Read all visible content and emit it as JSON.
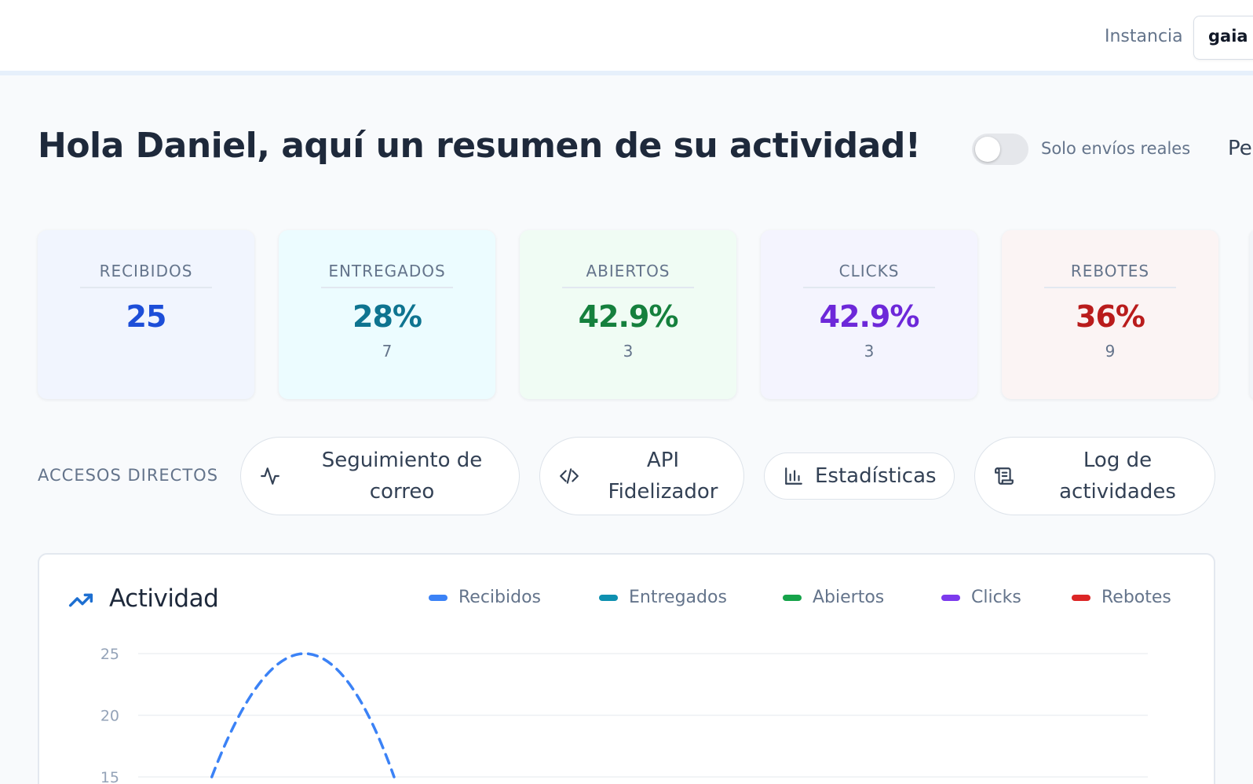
{
  "header": {
    "instance_label": "Instancia",
    "instance_value": "gaia"
  },
  "greeting": "Hola Daniel, aquí un resumen de su actividad!",
  "toggle": {
    "label": "Solo envíos reales",
    "checked": false
  },
  "truncated_text": "Pe",
  "stats": [
    {
      "title": "RECIBIDOS",
      "value": "25",
      "sub": "",
      "color": "#1d4ed8",
      "bg": "#f1f5fe"
    },
    {
      "title": "ENTREGADOS",
      "value": "28%",
      "sub": "7",
      "color": "#0e7490",
      "bg": "#ecfcff"
    },
    {
      "title": "ABIERTOS",
      "value": "42.9%",
      "sub": "3",
      "color": "#15803d",
      "bg": "#f0fcf4"
    },
    {
      "title": "CLICKS",
      "value": "42.9%",
      "sub": "3",
      "color": "#6d28d9",
      "bg": "#f4f4fe"
    },
    {
      "title": "REBOTES",
      "value": "36%",
      "sub": "9",
      "color": "#b91c1c",
      "bg": "#fbf4f4"
    }
  ],
  "shortcuts": {
    "label": "ACCESOS DIRECTOS",
    "items": [
      {
        "label": "Seguimiento de correo",
        "icon": "activity-icon"
      },
      {
        "label": "API Fidelizador",
        "icon": "code-icon"
      },
      {
        "label": "Estadísticas",
        "icon": "bar-chart-icon"
      },
      {
        "label": "Log de actividades",
        "icon": "scroll-icon"
      }
    ]
  },
  "activity": {
    "title": "Actividad",
    "icon": "trending-up-icon",
    "legend": [
      {
        "name": "Recibidos",
        "color": "#3b82f6"
      },
      {
        "name": "Entregados",
        "color": "#0e90b0"
      },
      {
        "name": "Abiertos",
        "color": "#16a34a"
      },
      {
        "name": "Clicks",
        "color": "#7c3aed"
      },
      {
        "name": "Rebotes",
        "color": "#dc2626"
      }
    ]
  },
  "chart_data": {
    "type": "line",
    "title": "Actividad",
    "xlabel": "",
    "ylabel": "",
    "ylim": [
      0,
      25
    ],
    "y_ticks": [
      25,
      20,
      15
    ],
    "grid": true,
    "legend_position": "top-right",
    "series": [
      {
        "name": "Recibidos",
        "style": "dashed",
        "points": [
          [
            0.45,
            15
          ],
          [
            1,
            25
          ],
          [
            1.53,
            15
          ]
        ]
      }
    ]
  }
}
